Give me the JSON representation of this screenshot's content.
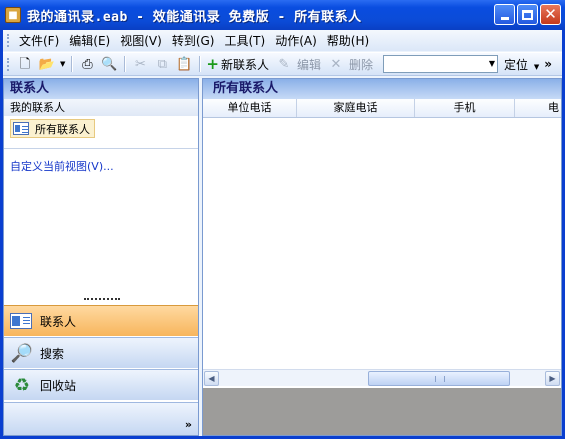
{
  "window": {
    "title": "我的通讯录.eab - 效能通讯录 免费版 - 所有联系人"
  },
  "menu": {
    "items": [
      "文件(F)",
      "编辑(E)",
      "视图(V)",
      "转到(G)",
      "工具(T)",
      "动作(A)",
      "帮助(H)"
    ]
  },
  "toolbar": {
    "new_contact_label": "新联系人",
    "edit_label": "编辑",
    "delete_label": "删除",
    "search_value": "",
    "locate_label": "定位",
    "overflow": "»"
  },
  "left_pane": {
    "header": "联系人",
    "section_title": "我的联系人",
    "folder_label": "所有联系人",
    "customize_link": "自定义当前视图(V)...",
    "nav_buttons": [
      {
        "label": "联系人",
        "icon": "contacts-card-icon",
        "active": true
      },
      {
        "label": "搜索",
        "icon": "magnifier-icon",
        "active": false
      },
      {
        "label": "回收站",
        "icon": "recycle-bin-icon",
        "active": false
      }
    ],
    "more_chevron": "»"
  },
  "right_pane": {
    "header": "所有联系人",
    "columns": [
      "单位电话",
      "家庭电话",
      "手机",
      "电"
    ]
  },
  "colors": {
    "title_bar": "#0b4bd7",
    "active_nav": "#f7b55c",
    "link": "#1637c9",
    "preview_area": "#9d9c9a"
  }
}
